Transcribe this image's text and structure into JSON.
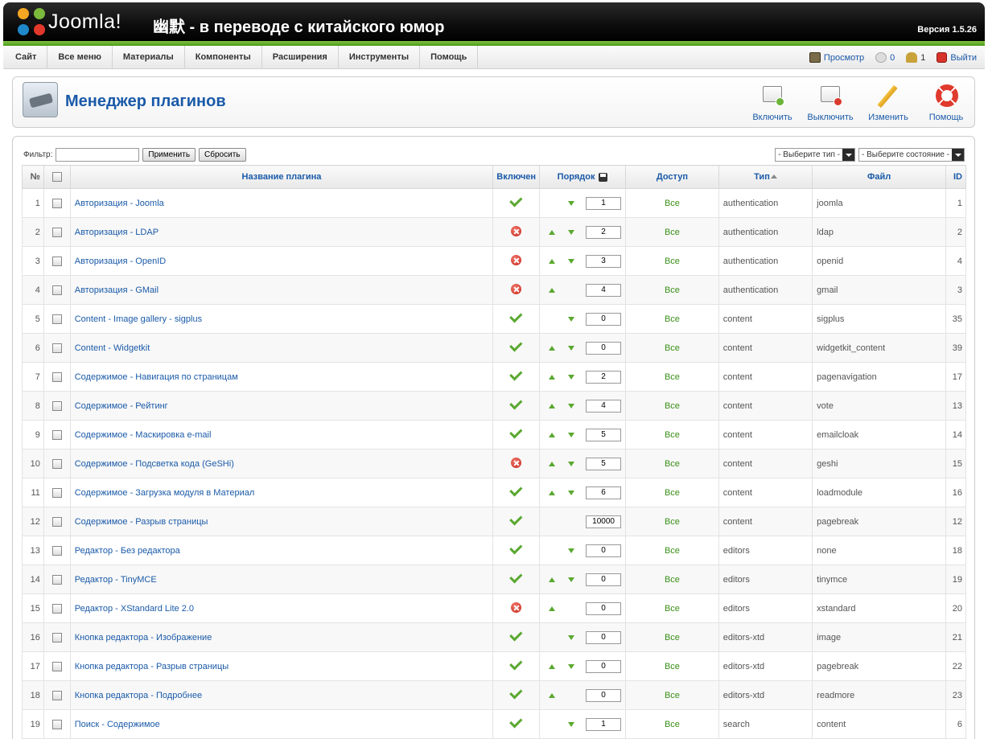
{
  "header": {
    "logo_text": "Joomla!",
    "site_title": "幽默 - в переводе с китайского юмор",
    "version": "Версия 1.5.26"
  },
  "menu": [
    "Сайт",
    "Все меню",
    "Материалы",
    "Компоненты",
    "Расширения",
    "Инструменты",
    "Помощь"
  ],
  "status": {
    "preview": "Просмотр",
    "messages": "0",
    "users": "1",
    "logout": "Выйти"
  },
  "toolbar": {
    "title": "Менеджер плагинов",
    "enable": "Включить",
    "disable": "Выключить",
    "edit": "Изменить",
    "help": "Помощь"
  },
  "filter": {
    "label": "Фильтр:",
    "value": "",
    "apply": "Применить",
    "reset": "Сбросить",
    "type_select": "- Выберите тип -",
    "state_select": "- Выберите состояние -"
  },
  "table": {
    "headers": {
      "num": "№",
      "name": "Название плагина",
      "enabled": "Включен",
      "order": "Порядок",
      "access": "Доступ",
      "type": "Тип",
      "file": "Файл",
      "id": "ID"
    },
    "rows": [
      {
        "num": "1",
        "name": "Авторизация - Joomla",
        "enabled": true,
        "up": false,
        "down": true,
        "order": "1",
        "access": "Все",
        "type": "authentication",
        "file": "joomla",
        "id": "1"
      },
      {
        "num": "2",
        "name": "Авторизация - LDAP",
        "enabled": false,
        "up": true,
        "down": true,
        "order": "2",
        "access": "Все",
        "type": "authentication",
        "file": "ldap",
        "id": "2"
      },
      {
        "num": "3",
        "name": "Авторизация - OpenID",
        "enabled": false,
        "up": true,
        "down": true,
        "order": "3",
        "access": "Все",
        "type": "authentication",
        "file": "openid",
        "id": "4"
      },
      {
        "num": "4",
        "name": "Авторизация - GMail",
        "enabled": false,
        "up": true,
        "down": false,
        "order": "4",
        "access": "Все",
        "type": "authentication",
        "file": "gmail",
        "id": "3"
      },
      {
        "num": "5",
        "name": "Content - Image gallery - sigplus",
        "enabled": true,
        "up": false,
        "down": true,
        "order": "0",
        "access": "Все",
        "type": "content",
        "file": "sigplus",
        "id": "35"
      },
      {
        "num": "6",
        "name": "Content - Widgetkit",
        "enabled": true,
        "up": true,
        "down": true,
        "order": "0",
        "access": "Все",
        "type": "content",
        "file": "widgetkit_content",
        "id": "39"
      },
      {
        "num": "7",
        "name": "Содержимое - Навигация по страницам",
        "enabled": true,
        "up": true,
        "down": true,
        "order": "2",
        "access": "Все",
        "type": "content",
        "file": "pagenavigation",
        "id": "17"
      },
      {
        "num": "8",
        "name": "Содержимое - Рейтинг",
        "enabled": true,
        "up": true,
        "down": true,
        "order": "4",
        "access": "Все",
        "type": "content",
        "file": "vote",
        "id": "13"
      },
      {
        "num": "9",
        "name": "Содержимое - Маскировка e-mail",
        "enabled": true,
        "up": true,
        "down": true,
        "order": "5",
        "access": "Все",
        "type": "content",
        "file": "emailcloak",
        "id": "14"
      },
      {
        "num": "10",
        "name": "Содержимое - Подсветка кода (GeSHi)",
        "enabled": false,
        "up": true,
        "down": true,
        "order": "5",
        "access": "Все",
        "type": "content",
        "file": "geshi",
        "id": "15"
      },
      {
        "num": "11",
        "name": "Содержимое - Загрузка модуля в Материал",
        "enabled": true,
        "up": true,
        "down": true,
        "order": "6",
        "access": "Все",
        "type": "content",
        "file": "loadmodule",
        "id": "16"
      },
      {
        "num": "12",
        "name": "Содержимое - Разрыв страницы",
        "enabled": true,
        "up": false,
        "down": false,
        "order": "10000",
        "access": "Все",
        "type": "content",
        "file": "pagebreak",
        "id": "12"
      },
      {
        "num": "13",
        "name": "Редактор - Без редактора",
        "enabled": true,
        "up": false,
        "down": true,
        "order": "0",
        "access": "Все",
        "type": "editors",
        "file": "none",
        "id": "18"
      },
      {
        "num": "14",
        "name": "Редактор - TinyMCE",
        "enabled": true,
        "up": true,
        "down": true,
        "order": "0",
        "access": "Все",
        "type": "editors",
        "file": "tinymce",
        "id": "19"
      },
      {
        "num": "15",
        "name": "Редактор - XStandard Lite 2.0",
        "enabled": false,
        "up": true,
        "down": false,
        "order": "0",
        "access": "Все",
        "type": "editors",
        "file": "xstandard",
        "id": "20"
      },
      {
        "num": "16",
        "name": "Кнопка редактора - Изображение",
        "enabled": true,
        "up": false,
        "down": true,
        "order": "0",
        "access": "Все",
        "type": "editors-xtd",
        "file": "image",
        "id": "21"
      },
      {
        "num": "17",
        "name": "Кнопка редактора - Разрыв страницы",
        "enabled": true,
        "up": true,
        "down": true,
        "order": "0",
        "access": "Все",
        "type": "editors-xtd",
        "file": "pagebreak",
        "id": "22"
      },
      {
        "num": "18",
        "name": "Кнопка редактора - Подробнее",
        "enabled": true,
        "up": true,
        "down": false,
        "order": "0",
        "access": "Все",
        "type": "editors-xtd",
        "file": "readmore",
        "id": "23"
      },
      {
        "num": "19",
        "name": "Поиск - Содержимое",
        "enabled": true,
        "up": false,
        "down": true,
        "order": "1",
        "access": "Все",
        "type": "search",
        "file": "content",
        "id": "6"
      }
    ]
  }
}
